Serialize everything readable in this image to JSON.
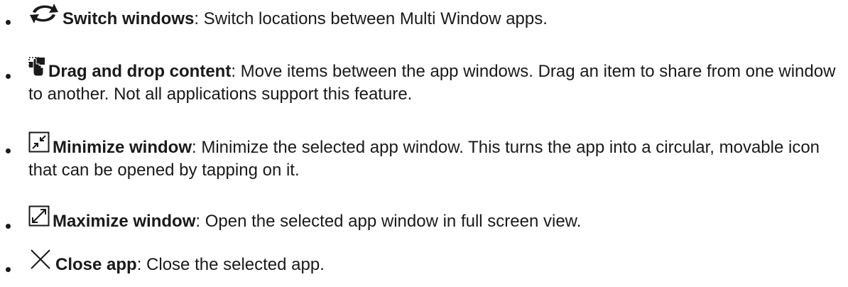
{
  "items": [
    {
      "icon": "switch-windows-icon",
      "term": "Switch windows",
      "desc": ": Switch locations between Multi Window apps."
    },
    {
      "icon": "drag-and-drop-icon",
      "term": "Drag and drop content",
      "desc": ": Move items between the app windows. Drag an item to share from one window to another. Not all applications support this feature."
    },
    {
      "icon": "minimize-window-icon",
      "term": "Minimize window",
      "desc": ": Minimize the selected app window. This turns the app into a circular, movable icon that can be opened by tapping on it."
    },
    {
      "icon": "maximize-window-icon",
      "term": "Maximize window",
      "desc": ": Open the selected app window in full screen view."
    },
    {
      "icon": "close-icon",
      "term": "Close app",
      "desc": ": Close the selected app."
    }
  ]
}
